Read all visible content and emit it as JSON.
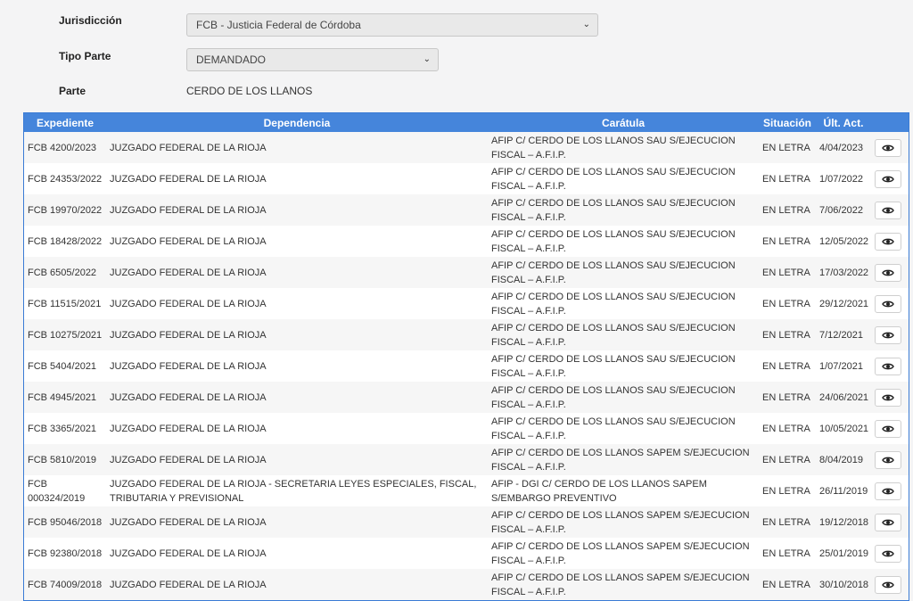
{
  "filters": {
    "jurisdiccion_label": "Jurisdicción",
    "jurisdiccion_value": "FCB - Justicia Federal de Córdoba",
    "tipo_parte_label": "Tipo Parte",
    "tipo_parte_value": "DEMANDADO",
    "parte_label": "Parte",
    "parte_value": "CERDO DE LOS LLANOS"
  },
  "table": {
    "headers": [
      "Expediente",
      "Dependencia",
      "Carátula",
      "Situación",
      "Últ. Act."
    ],
    "rows": [
      {
        "exp": "FCB 4200/2023",
        "dep": "JUZGADO FEDERAL DE LA RIOJA",
        "car": "AFIP C/ CERDO DE LOS LLANOS SAU S/EJECUCION FISCAL – A.F.I.P.",
        "sit": "EN LETRA",
        "act": "4/04/2023"
      },
      {
        "exp": "FCB 24353/2022",
        "dep": "JUZGADO FEDERAL DE LA RIOJA",
        "car": "AFIP C/ CERDO DE LOS LLANOS SAU S/EJECUCION FISCAL – A.F.I.P.",
        "sit": "EN LETRA",
        "act": "1/07/2022"
      },
      {
        "exp": "FCB 19970/2022",
        "dep": "JUZGADO FEDERAL DE LA RIOJA",
        "car": "AFIP C/ CERDO DE LOS LLANOS SAU S/EJECUCION FISCAL – A.F.I.P.",
        "sit": "EN LETRA",
        "act": "7/06/2022"
      },
      {
        "exp": "FCB 18428/2022",
        "dep": "JUZGADO FEDERAL DE LA RIOJA",
        "car": "AFIP C/ CERDO DE LOS LLANOS SAU S/EJECUCION FISCAL – A.F.I.P.",
        "sit": "EN LETRA",
        "act": "12/05/2022"
      },
      {
        "exp": "FCB 6505/2022",
        "dep": "JUZGADO FEDERAL DE LA RIOJA",
        "car": "AFIP C/ CERDO DE LOS LLANOS SAU S/EJECUCION FISCAL – A.F.I.P.",
        "sit": "EN LETRA",
        "act": "17/03/2022"
      },
      {
        "exp": "FCB 11515/2021",
        "dep": "JUZGADO FEDERAL DE LA RIOJA",
        "car": "AFIP C/ CERDO DE LOS LLANOS SAU S/EJECUCION FISCAL – A.F.I.P.",
        "sit": "EN LETRA",
        "act": "29/12/2021"
      },
      {
        "exp": "FCB 10275/2021",
        "dep": "JUZGADO FEDERAL DE LA RIOJA",
        "car": "AFIP C/ CERDO DE LOS LLANOS SAU S/EJECUCION FISCAL – A.F.I.P.",
        "sit": "EN LETRA",
        "act": "7/12/2021"
      },
      {
        "exp": "FCB 5404/2021",
        "dep": "JUZGADO FEDERAL DE LA RIOJA",
        "car": "AFIP C/ CERDO DE LOS LLANOS SAU S/EJECUCION FISCAL – A.F.I.P.",
        "sit": "EN LETRA",
        "act": "1/07/2021"
      },
      {
        "exp": "FCB 4945/2021",
        "dep": "JUZGADO FEDERAL DE LA RIOJA",
        "car": "AFIP C/ CERDO DE LOS LLANOS SAU S/EJECUCION FISCAL – A.F.I.P.",
        "sit": "EN LETRA",
        "act": "24/06/2021"
      },
      {
        "exp": "FCB 3365/2021",
        "dep": "JUZGADO FEDERAL DE LA RIOJA",
        "car": "AFIP C/ CERDO DE LOS LLANOS SAU S/EJECUCION FISCAL – A.F.I.P.",
        "sit": "EN LETRA",
        "act": "10/05/2021"
      },
      {
        "exp": "FCB 5810/2019",
        "dep": "JUZGADO FEDERAL DE LA RIOJA",
        "car": "AFIP C/ CERDO DE LOS LLANOS SAPEM S/EJECUCION FISCAL – A.F.I.P.",
        "sit": "EN LETRA",
        "act": "8/04/2019"
      },
      {
        "exp": "FCB 000324/2019",
        "dep": "JUZGADO FEDERAL DE LA RIOJA - SECRETARIA LEYES ESPECIALES, FISCAL, TRIBUTARIA Y PREVISIONAL",
        "car": "AFIP - DGI C/ CERDO DE LOS LLANOS SAPEM S/EMBARGO PREVENTIVO",
        "sit": "EN LETRA",
        "act": "26/11/2019"
      },
      {
        "exp": "FCB 95046/2018",
        "dep": "JUZGADO FEDERAL DE LA RIOJA",
        "car": "AFIP C/ CERDO DE LOS LLANOS SAPEM S/EJECUCION FISCAL – A.F.I.P.",
        "sit": "EN LETRA",
        "act": "19/12/2018"
      },
      {
        "exp": "FCB 92380/2018",
        "dep": "JUZGADO FEDERAL DE LA RIOJA",
        "car": "AFIP C/ CERDO DE LOS LLANOS SAPEM S/EJECUCION FISCAL – A.F.I.P.",
        "sit": "EN LETRA",
        "act": "25/01/2019"
      },
      {
        "exp": "FCB 74009/2018",
        "dep": "JUZGADO FEDERAL DE LA RIOJA",
        "car": "AFIP C/ CERDO DE LOS LLANOS SAPEM S/EJECUCION FISCAL – A.F.I.P.",
        "sit": "EN LETRA",
        "act": "30/10/2018"
      }
    ],
    "action_icon": "eye-icon"
  },
  "colors": {
    "header_bg": "#4585db",
    "header_text": "#ffffff"
  }
}
